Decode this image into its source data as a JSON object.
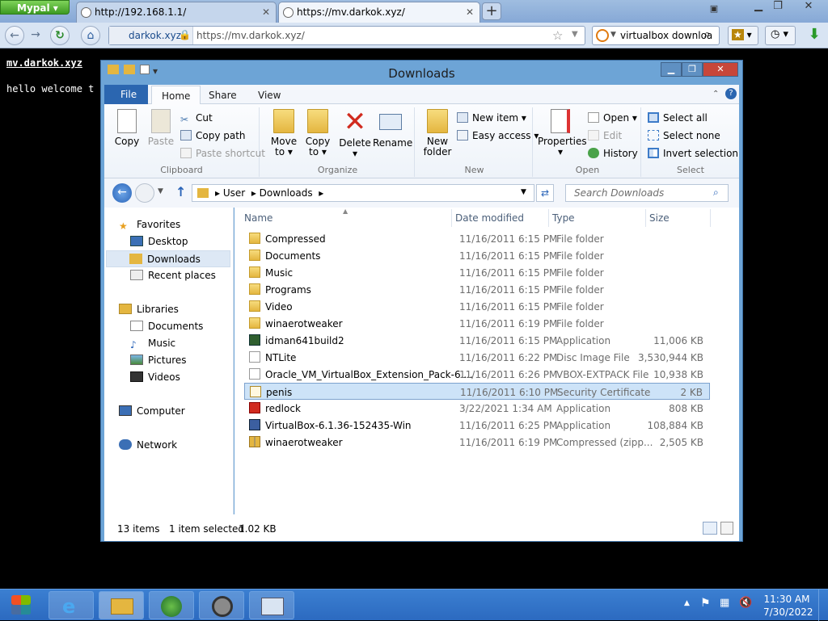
{
  "browser": {
    "brand": "Mypal",
    "tabs": [
      {
        "title": "http://192.168.1.1/",
        "active": false
      },
      {
        "title": "https://mv.darkok.xyz/",
        "active": true
      }
    ],
    "identity": "darkok.xyz",
    "url": "https://mv.darkok.xyz/",
    "search_value": "virtualbox downloa"
  },
  "page": {
    "heading": "mv.darkok.xyz",
    "text": "hello welcome t"
  },
  "explorer": {
    "title": "Downloads",
    "ribbon_tabs": [
      "File",
      "Home",
      "Share",
      "View"
    ],
    "clipboard": {
      "copy": "Copy",
      "paste": "Paste",
      "cut": "Cut",
      "copy_path": "Copy path",
      "paste_shortcut": "Paste shortcut",
      "label": "Clipboard"
    },
    "organize": {
      "move": "Move",
      "move2": "to",
      "copy": "Copy",
      "copy2": "to",
      "delete": "Delete",
      "rename": "Rename",
      "label": "Organize"
    },
    "new": {
      "folder": "New",
      "folder2": "folder",
      "new_item": "New item",
      "easy_access": "Easy access",
      "label": "New"
    },
    "open": {
      "properties": "Properties",
      "open": "Open",
      "edit": "Edit",
      "history": "History",
      "label": "Open"
    },
    "select": {
      "all": "Select all",
      "none": "Select none",
      "invert": "Invert selection",
      "label": "Select"
    },
    "breadcrumb": [
      "User",
      "Downloads"
    ],
    "search_placeholder": "Search Downloads",
    "nav": {
      "favorites": "Favorites",
      "desktop": "Desktop",
      "downloads": "Downloads",
      "recent": "Recent places",
      "libraries": "Libraries",
      "documents": "Documents",
      "music": "Music",
      "pictures": "Pictures",
      "videos": "Videos",
      "computer": "Computer",
      "network": "Network"
    },
    "columns": [
      "Name",
      "Date modified",
      "Type",
      "Size"
    ],
    "files": [
      {
        "name": "Compressed",
        "date": "11/16/2011 6:15 PM",
        "type": "File folder",
        "size": "",
        "icon": "folder"
      },
      {
        "name": "Documents",
        "date": "11/16/2011 6:15 PM",
        "type": "File folder",
        "size": "",
        "icon": "folder"
      },
      {
        "name": "Music",
        "date": "11/16/2011 6:15 PM",
        "type": "File folder",
        "size": "",
        "icon": "folder"
      },
      {
        "name": "Programs",
        "date": "11/16/2011 6:15 PM",
        "type": "File folder",
        "size": "",
        "icon": "folder"
      },
      {
        "name": "Video",
        "date": "11/16/2011 6:15 PM",
        "type": "File folder",
        "size": "",
        "icon": "folder"
      },
      {
        "name": "winaerotweaker",
        "date": "11/16/2011 6:19 PM",
        "type": "File folder",
        "size": "",
        "icon": "folder"
      },
      {
        "name": "idman641build2",
        "date": "11/16/2011 6:15 PM",
        "type": "Application",
        "size": "11,006 KB",
        "icon": "app"
      },
      {
        "name": "NTLite",
        "date": "11/16/2011 6:22 PM",
        "type": "Disc Image File",
        "size": "3,530,944 KB",
        "icon": "file"
      },
      {
        "name": "Oracle_VM_VirtualBox_Extension_Pack-6....",
        "date": "11/16/2011 6:26 PM",
        "type": "VBOX-EXTPACK File",
        "size": "10,938 KB",
        "icon": "file"
      },
      {
        "name": "penis",
        "date": "11/16/2011 6:10 PM",
        "type": "Security Certificate",
        "size": "2 KB",
        "icon": "cert",
        "selected": true
      },
      {
        "name": "redlock",
        "date": "3/22/2021 1:34 AM",
        "type": "Application",
        "size": "808 KB",
        "icon": "red"
      },
      {
        "name": "VirtualBox-6.1.36-152435-Win",
        "date": "11/16/2011 6:25 PM",
        "type": "Application",
        "size": "108,884 KB",
        "icon": "vbox"
      },
      {
        "name": "winaerotweaker",
        "date": "11/16/2011 6:19 PM",
        "type": "Compressed (zipp...",
        "size": "2,505 KB",
        "icon": "zip"
      }
    ],
    "status": {
      "count": "13 items",
      "selected": "1 item selected",
      "size": "1.02 KB"
    }
  },
  "taskbar": {
    "time": "11:30 AM",
    "date": "7/30/2022"
  }
}
